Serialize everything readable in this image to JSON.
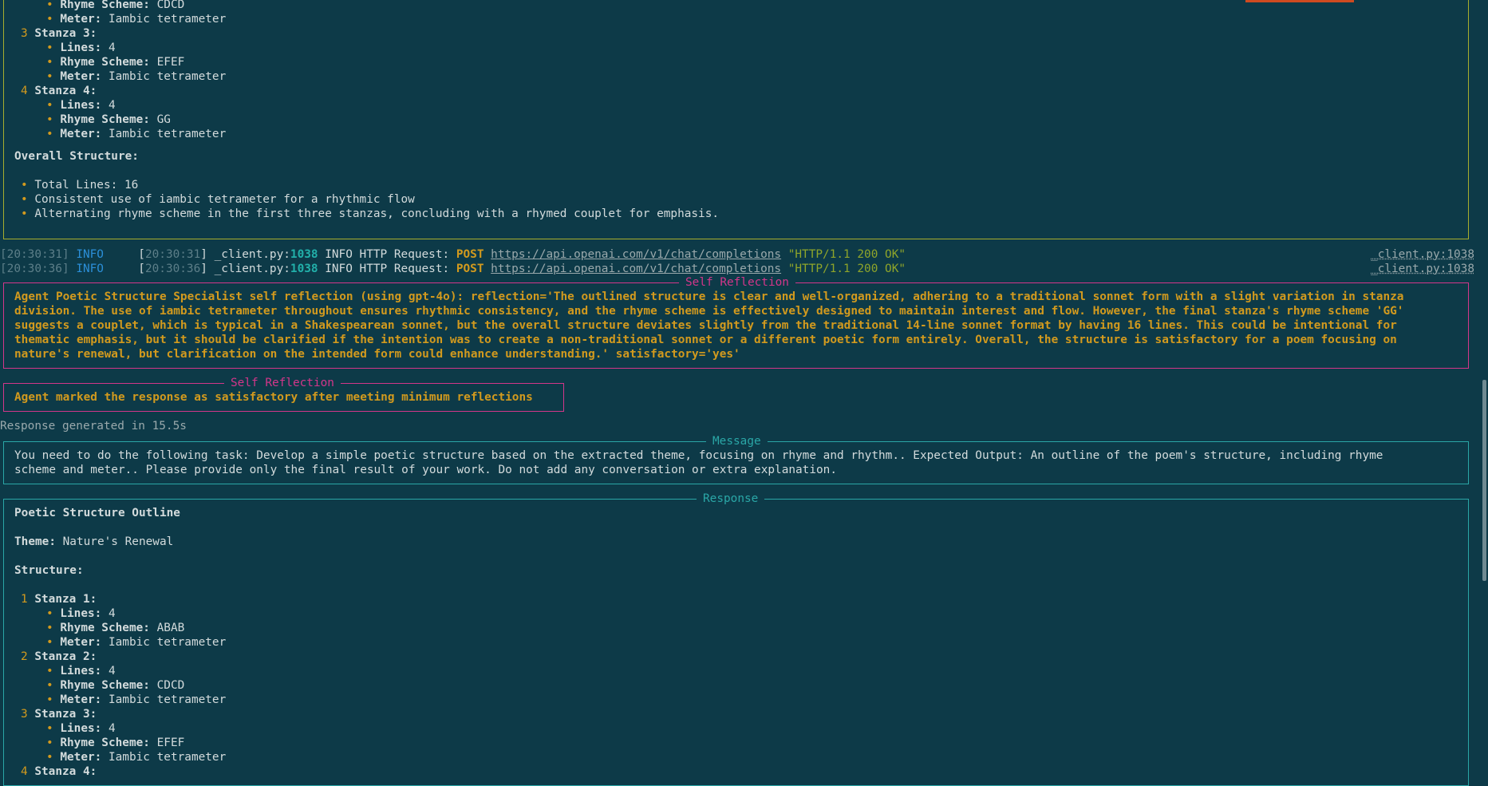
{
  "top_block": {
    "lines": [
      {
        "kind": "sub",
        "label": "Rhyme Scheme:",
        "value": " CDCD"
      },
      {
        "kind": "sub",
        "label": "Meter:",
        "value": " Iambic tetrameter"
      },
      {
        "kind": "num",
        "num": "3",
        "text": "Stanza 3:"
      },
      {
        "kind": "sub",
        "label": "Lines:",
        "value": " 4"
      },
      {
        "kind": "sub",
        "label": "Rhyme Scheme:",
        "value": " EFEF"
      },
      {
        "kind": "sub",
        "label": "Meter:",
        "value": " Iambic tetrameter"
      },
      {
        "kind": "num",
        "num": "4",
        "text": "Stanza 4:"
      },
      {
        "kind": "sub",
        "label": "Lines:",
        "value": " 4"
      },
      {
        "kind": "sub",
        "label": "Rhyme Scheme:",
        "value": " GG"
      },
      {
        "kind": "sub",
        "label": "Meter:",
        "value": " Iambic tetrameter"
      }
    ],
    "overall_heading": "Overall Structure:",
    "overall_items": [
      "Total Lines: 16",
      "Consistent use of iambic tetrameter for a rhythmic flow",
      "Alternating rhyme scheme in the first three stanzas, concluding with a rhymed couplet for emphasis."
    ]
  },
  "logs": [
    {
      "time": "[20:30:31]",
      "level": "INFO",
      "ts": "20:30:31",
      "file": " _client.py:",
      "line": "1038",
      "msg": " INFO HTTP Request: ",
      "method": "POST",
      "url": "https://api.openai.com/v1/chat/completions",
      "status": "\"HTTP/1.1 200 OK\"",
      "src": "_client.py:1038"
    },
    {
      "time": "[20:30:36]",
      "level": "INFO",
      "ts": "20:30:36",
      "file": " _client.py:",
      "line": "1038",
      "msg": " INFO HTTP Request: ",
      "method": "POST",
      "url": "https://api.openai.com/v1/chat/completions",
      "status": "\"HTTP/1.1 200 OK\"",
      "src": "_client.py:1038"
    }
  ],
  "reflection1": {
    "title": "Self Reflection",
    "lines": [
      "Agent Poetic Structure Specialist self reflection (using gpt-4o): reflection='The outlined structure is clear and well-organized, adhering to a traditional sonnet form with a slight variation in stanza",
      "division. The use of iambic tetrameter throughout ensures rhythmic consistency, and the rhyme scheme is effectively designed to maintain interest and flow. However, the final stanza's rhyme scheme 'GG'",
      "suggests a couplet, which is typical in a Shakespearean sonnet, but the overall structure deviates slightly from the traditional 14-line sonnet format by having 16 lines. This could be intentional for",
      "thematic emphasis, but it should be clarified if the intention was to create a non-traditional sonnet or a different poetic form entirely. Overall, the structure is satisfactory for a poem focusing on",
      "nature's renewal, but clarification on the intended form could enhance understanding.' satisfactory='yes'"
    ]
  },
  "reflection2": {
    "title": "Self Reflection",
    "text": "Agent marked the response as satisfactory after meeting minimum reflections"
  },
  "response_time": "Response generated in 15.5s",
  "message": {
    "title": "Message",
    "lines": [
      "You need to do the following task: Develop a simple poetic structure based on the extracted theme, focusing on rhyme and rhythm.. Expected Output: An outline of the poem's structure, including rhyme",
      "scheme and meter.. Please provide only the final result of your work. Do not add any conversation or extra explanation."
    ]
  },
  "response": {
    "title": "Response",
    "heading": "Poetic Structure Outline",
    "theme_label": "Theme:",
    "theme_value": " Nature's Renewal",
    "structure_label": "Structure:",
    "lines": [
      {
        "kind": "num",
        "num": "1",
        "text": "Stanza 1:"
      },
      {
        "kind": "sub",
        "label": "Lines:",
        "value": " 4"
      },
      {
        "kind": "sub",
        "label": "Rhyme Scheme:",
        "value": " ABAB"
      },
      {
        "kind": "sub",
        "label": "Meter:",
        "value": " Iambic tetrameter"
      },
      {
        "kind": "num",
        "num": "2",
        "text": "Stanza 2:"
      },
      {
        "kind": "sub",
        "label": "Lines:",
        "value": " 4"
      },
      {
        "kind": "sub",
        "label": "Rhyme Scheme:",
        "value": " CDCD"
      },
      {
        "kind": "sub",
        "label": "Meter:",
        "value": " Iambic tetrameter"
      },
      {
        "kind": "num",
        "num": "3",
        "text": "Stanza 3:"
      },
      {
        "kind": "sub",
        "label": "Lines:",
        "value": " 4"
      },
      {
        "kind": "sub",
        "label": "Rhyme Scheme:",
        "value": " EFEF"
      },
      {
        "kind": "sub",
        "label": "Meter:",
        "value": " Iambic tetrameter"
      },
      {
        "kind": "num",
        "num": "4",
        "text": "Stanza 4:"
      }
    ]
  }
}
